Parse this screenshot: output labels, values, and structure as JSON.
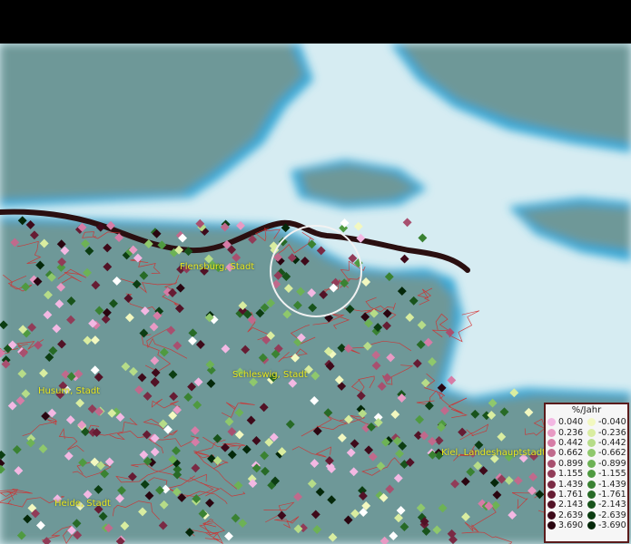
{
  "places": [
    {
      "name": "Flensburg, Stadt"
    },
    {
      "name": "Schleswig, Stadt"
    },
    {
      "name": "Husum, Stadt"
    },
    {
      "name": "Kiel, Landeshauptstadt"
    },
    {
      "name": "Heide, Stadt"
    }
  ],
  "legend": {
    "title": "%/Jahr",
    "positive": [
      {
        "label": "0.040",
        "color": "#f3b8e3"
      },
      {
        "label": "0.236",
        "color": "#e89ac4"
      },
      {
        "label": "0.442",
        "color": "#d67ca6"
      },
      {
        "label": "0.662",
        "color": "#c06a8c"
      },
      {
        "label": "0.899",
        "color": "#a8506f"
      },
      {
        "label": "1.155",
        "color": "#913c58"
      },
      {
        "label": "1.439",
        "color": "#7a2a44"
      },
      {
        "label": "1.761",
        "color": "#661c33"
      },
      {
        "label": "2.143",
        "color": "#521226"
      },
      {
        "label": "2.639",
        "color": "#3e0a1a"
      },
      {
        "label": "3.690",
        "color": "#2a0510"
      }
    ],
    "negative": [
      {
        "label": "-0.040",
        "color": "#f2f8c0"
      },
      {
        "label": "-0.236",
        "color": "#d9eda0"
      },
      {
        "label": "-0.442",
        "color": "#b6dc88"
      },
      {
        "label": "-0.662",
        "color": "#8fc86c"
      },
      {
        "label": "-0.899",
        "color": "#6db255"
      },
      {
        "label": "-1.155",
        "color": "#4f9a40"
      },
      {
        "label": "-1.439",
        "color": "#3a8232"
      },
      {
        "label": "-1.761",
        "color": "#276a26"
      },
      {
        "label": "-2.143",
        "color": "#18531b"
      },
      {
        "label": "-2.639",
        "color": "#0c3d12"
      },
      {
        "label": "-3.690",
        "color": "#04280a"
      }
    ]
  },
  "colors": {
    "water": "#d6ecf2",
    "land": "#6e9898",
    "coast": "#2ea6d6",
    "border": "#d62a2a",
    "road": "#2a0f10",
    "label": "#e8e820"
  }
}
